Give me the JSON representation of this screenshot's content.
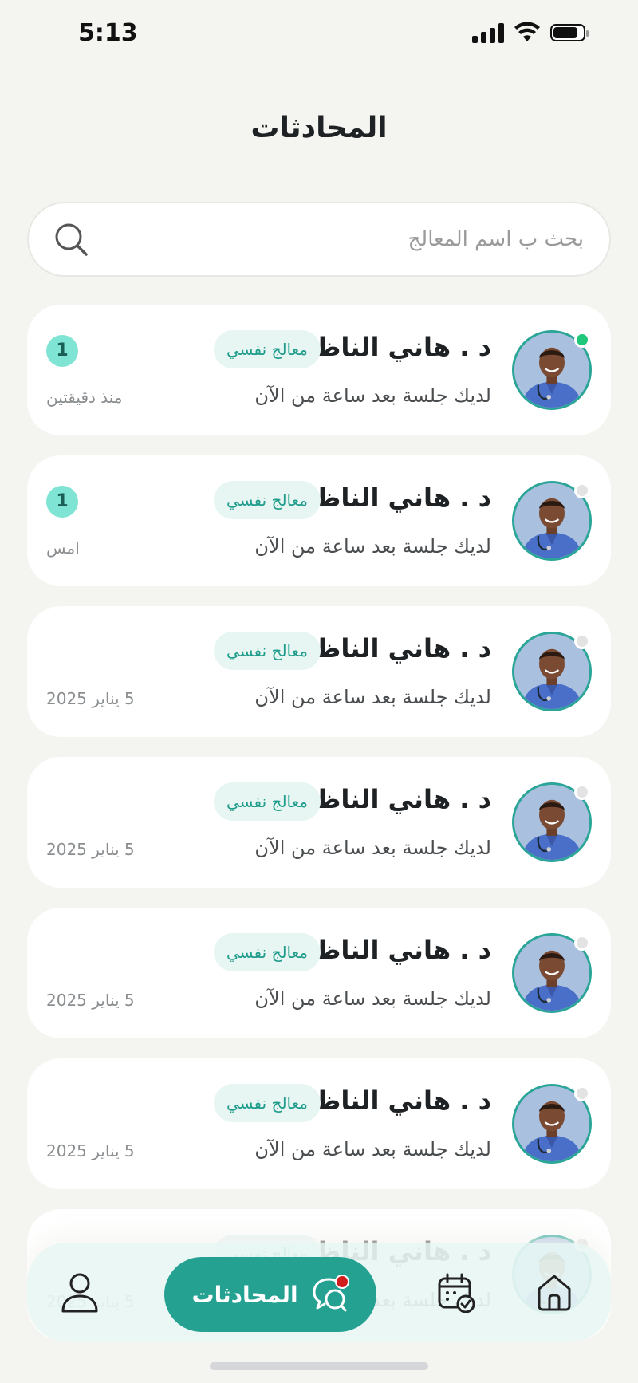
{
  "status_bar": {
    "time": "5:13"
  },
  "header": {
    "title": "المحادثات"
  },
  "search": {
    "placeholder": "بحث ب اسم المعالج",
    "value": ""
  },
  "colors": {
    "accent": "#25a192",
    "online": "#1ec77a",
    "offline": "#e3e3e3",
    "badge_bg": "#e7f6f3",
    "notification": "#d11d1d"
  },
  "chats": [
    {
      "name": "د . هاني الناظر",
      "role": "معالج نفسي",
      "message": "لديك جلسة بعد ساعة من الآن",
      "time": "منذ دقيقتين",
      "unread": "1",
      "online": true
    },
    {
      "name": "د . هاني الناظر",
      "role": "معالج نفسي",
      "message": "لديك جلسة بعد ساعة من الآن",
      "time": "امس",
      "unread": "1",
      "online": false
    },
    {
      "name": "د . هاني الناظر",
      "role": "معالج نفسي",
      "message": "لديك جلسة بعد ساعة من الآن",
      "time": "5 يناير 2025",
      "unread": "",
      "online": false
    },
    {
      "name": "د . هاني الناظر",
      "role": "معالج نفسي",
      "message": "لديك جلسة بعد ساعة من الآن",
      "time": "5 يناير 2025",
      "unread": "",
      "online": false
    },
    {
      "name": "د . هاني الناظر",
      "role": "معالج نفسي",
      "message": "لديك جلسة بعد ساعة من الآن",
      "time": "5 يناير 2025",
      "unread": "",
      "online": false
    },
    {
      "name": "د . هاني الناظر",
      "role": "معالج نفسي",
      "message": "لديك جلسة بعد ساعة من الآن",
      "time": "5 يناير 2025",
      "unread": "",
      "online": false
    },
    {
      "name": "د . هاني الناظر",
      "role": "معالج نفسي",
      "message": "لديك جلسة بعد ساعة من الآن",
      "time": "5 يناير 2025",
      "unread": "",
      "online": false
    }
  ],
  "bottom_nav": {
    "items": [
      {
        "icon": "profile-icon",
        "active": false
      },
      {
        "icon": "chat-icon",
        "label": "المحادثات",
        "active": true,
        "has_notification": true
      },
      {
        "icon": "calendar-check-icon",
        "active": false
      },
      {
        "icon": "home-icon",
        "active": false
      }
    ]
  }
}
